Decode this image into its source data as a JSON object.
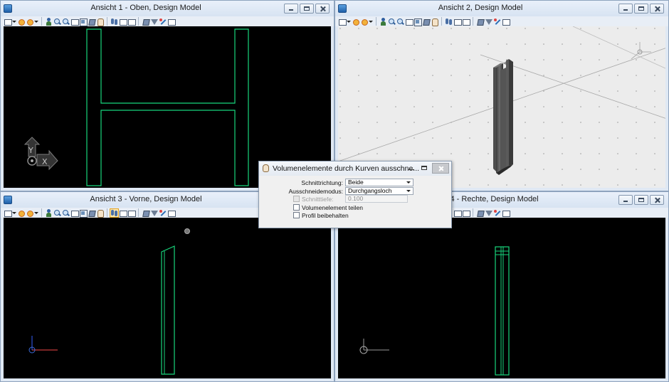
{
  "views": [
    {
      "id": "view1",
      "title": "Ansicht 1 - Oben, Design Model",
      "axis_labels": {
        "y": "Y",
        "x": "X"
      }
    },
    {
      "id": "view2",
      "title": "Ansicht 2, Design Model"
    },
    {
      "id": "view3",
      "title": "Ansicht 3 - Vorne, Design Model"
    },
    {
      "id": "view4",
      "title": "Ansicht 4 - Rechte, Design Model"
    }
  ],
  "dialog": {
    "title": "Volumenelemente durch Kurven ausschne...",
    "schnittrichtung": {
      "label": "Schnittrichtung:",
      "value": "Beide"
    },
    "ausschneidemodus": {
      "label": "Ausschneidemodus:",
      "value": "Durchgangsloch"
    },
    "schnitttiefe": {
      "label": "Schnitttiefe:",
      "value": "0.100",
      "enabled": false
    },
    "volumenelement_teilen": {
      "label": "Volumenelement teilen",
      "checked": false
    },
    "profil_beibehalten": {
      "label": "Profil beibehalten",
      "checked": false
    }
  },
  "colors": {
    "element": "#17d67c",
    "viewport_bg": "#000000",
    "window_frame": "#dfe8f4"
  },
  "icons": [
    "view-attributes-icon",
    "dropdown-icon",
    "render-icon",
    "light-icon",
    "walk-icon",
    "zoom-in-icon",
    "zoom-out-icon",
    "window-area-icon",
    "fit-view-icon",
    "rotate-view-icon",
    "pan-icon",
    "previous-view-icon",
    "next-view-icon",
    "copy-view-icon",
    "clip-volume-icon",
    "clip-mask-icon",
    "camera-icon",
    "display-style-icon"
  ]
}
